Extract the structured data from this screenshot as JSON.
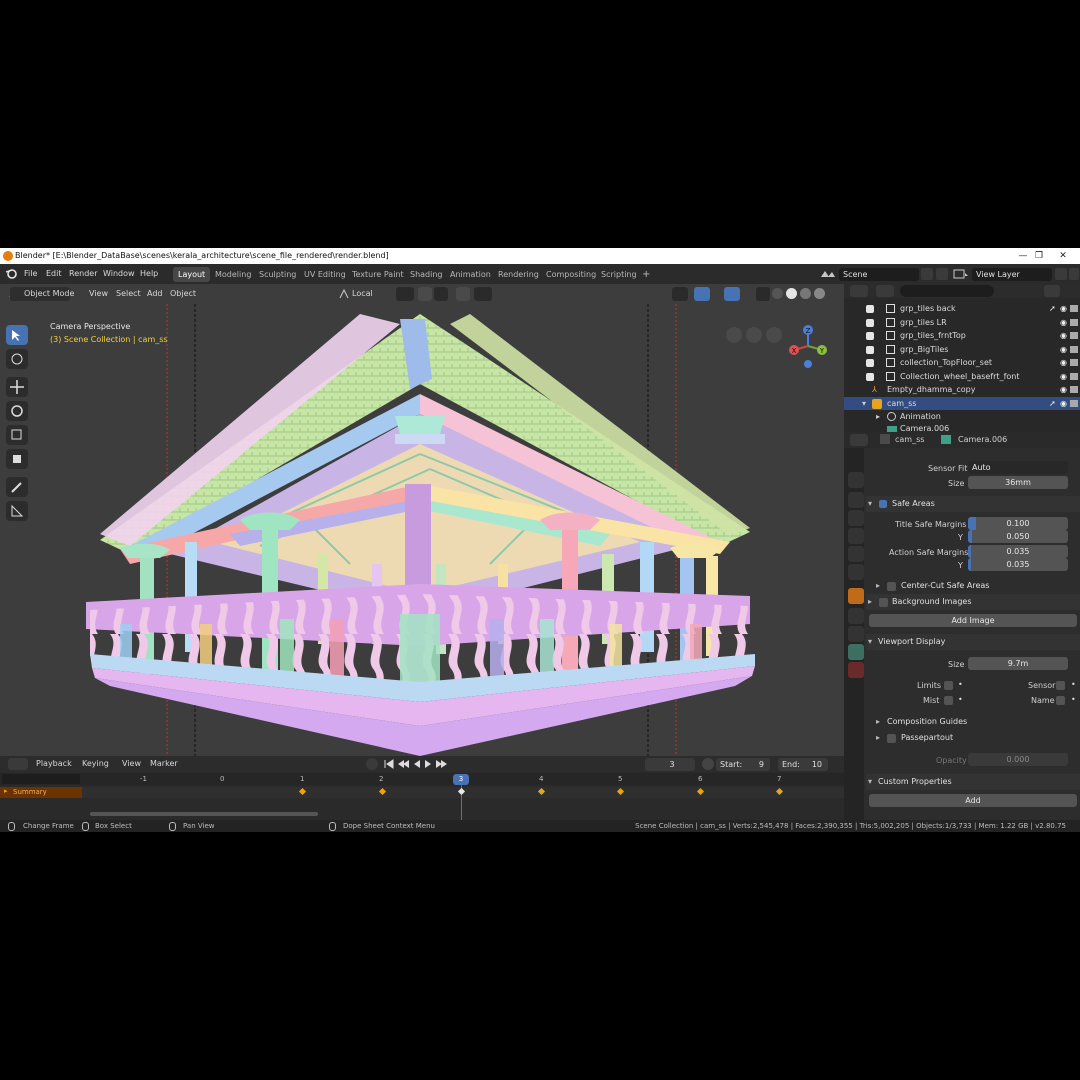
{
  "window": {
    "title": "Blender* [E:\\Blender_DataBase\\scenes\\kerala_architecture\\scene_file_rendered\\render.blend]",
    "controls": [
      "—",
      "❐",
      "✕"
    ]
  },
  "menu": [
    "File",
    "Edit",
    "Render",
    "Window",
    "Help"
  ],
  "workspaces": [
    "Layout",
    "Modeling",
    "Sculpting",
    "UV Editing",
    "Texture Paint",
    "Shading",
    "Animation",
    "Rendering",
    "Compositing",
    "Scripting"
  ],
  "add_workspace": "+",
  "scene_field": "Scene",
  "view_layer_field": "View Layer",
  "viewport": {
    "mode": "Object Mode",
    "menus": [
      "View",
      "Select",
      "Add",
      "Object"
    ],
    "transform_orientation": "Local",
    "overlay_title": "Camera Perspective",
    "overlay_sub": "(3) Scene Collection | cam_ss",
    "gizmo": {
      "z": "Z",
      "y": "Y",
      "x": "X"
    }
  },
  "timeline": {
    "menus": [
      "Playback",
      "Keying",
      "View",
      "Marker"
    ],
    "current_frame": "3",
    "start_label": "Start:",
    "start": "9",
    "end_label": "End:",
    "end": "10",
    "ruler": [
      "-1",
      "0",
      "1",
      "2",
      "3",
      "4",
      "5",
      "6",
      "7"
    ],
    "channel": "Summary"
  },
  "outliner": {
    "rows": [
      {
        "label": "grp_tiles back"
      },
      {
        "label": "grp_tiles LR"
      },
      {
        "label": "grp_tiles_frntTop"
      },
      {
        "label": "grp_BigTiles"
      },
      {
        "label": "collection_TopFloor_set"
      },
      {
        "label": "Collection_wheel_basefrt_font"
      },
      {
        "label": "Empty_dhamma_copy"
      },
      {
        "label": "cam_ss"
      },
      {
        "label": "Animation"
      },
      {
        "label": "Camera.006"
      }
    ]
  },
  "properties": {
    "breadcrumb_obj": "cam_ss",
    "breadcrumb_data": "Camera.006",
    "sensor_fit_label": "Sensor Fit",
    "sensor_fit_value": "Auto",
    "size_label": "Size",
    "size_value": "36mm",
    "safe_areas": "Safe Areas",
    "title_safe_label": "Title Safe Margins X",
    "title_safe_x": "0.100",
    "y_label": "Y",
    "title_safe_y": "0.050",
    "action_safe_label": "Action Safe Margins X",
    "action_safe_x": "0.035",
    "action_safe_y": "0.035",
    "center_cut": "Center-Cut Safe Areas",
    "background_images": "Background Images",
    "add_image": "Add Image",
    "viewport_display": "Viewport Display",
    "vd_size_label": "Size",
    "vd_size_value": "9.7m",
    "limits": "Limits",
    "sensor": "Sensor",
    "mist": "Mist",
    "name": "Name",
    "composition_guides": "Composition Guides",
    "passepartout": "Passepartout",
    "opacity_label": "Opacity",
    "opacity_value": "0.000",
    "custom_properties": "Custom Properties",
    "add": "Add"
  },
  "statusbar": {
    "change_frame": "Change Frame",
    "box_select": "Box Select",
    "pan_view": "Pan View",
    "context_menu": "Dope Sheet Context Menu",
    "stats": "Scene Collection | cam_ss | Verts:2,545,478 | Faces:2,390,355 | Tris:5,002,205 | Objects:1/3,733 | Mem: 1.22 GB | v2.80.75"
  },
  "colors": {
    "accent": "#4772b3",
    "brand": "#e87d0d",
    "keyframe": "#e8a41c"
  }
}
